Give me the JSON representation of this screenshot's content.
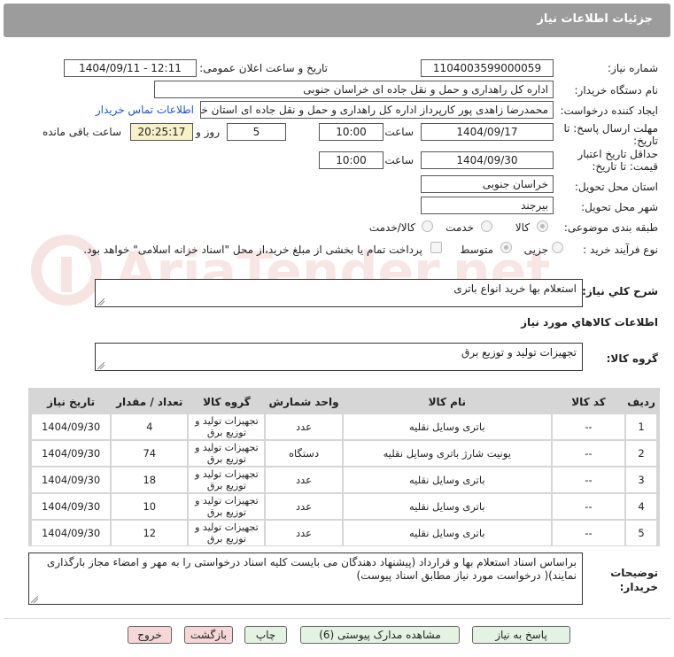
{
  "header": {
    "title": "جزئیات اطلاعات نیاز"
  },
  "fields": {
    "need_number_label": "شماره نیاز:",
    "need_number": "1104003599000059",
    "announce_label": "تاریخ و ساعت اعلان عمومی:",
    "announce_value": "1404/09/11 - 12:11",
    "buyer_org_label": "نام دستگاه خریدار:",
    "buyer_org": "اداره کل راهداری و حمل و نقل جاده ای خراسان جنوبی",
    "creator_label": "ایجاد کننده درخواست:",
    "creator": "محمدرضا زاهدی پور کارپرداز اداره کل راهداری و حمل و نقل جاده ای استان خراسا",
    "contact_link": "اطلاعات تماس خریدار",
    "deadline_label": "مهلت ارسال پاسخ: تا",
    "deadline_label2": "تاریخ:",
    "deadline_date": "1404/09/17",
    "time_label": "ساعت",
    "deadline_time": "10:00",
    "days": "5",
    "days_label": "روز و",
    "remaining_time": "20:25:17",
    "remaining_label": "ساعت باقی مانده",
    "validity_label": "حداقل تاریخ اعتبار",
    "validity_label2": "قیمت: تا تاریخ:",
    "validity_date": "1404/09/30",
    "validity_time_label": "ساعت",
    "validity_time": "10:00",
    "province_label": "استان محل تحویل:",
    "province": "خراسان جنوبی",
    "city_label": "شهر محل تحویل:",
    "city": "بیرجند",
    "category_label": "طبقه بندی موضوعی:",
    "category_options": [
      "کالا",
      "خدمت",
      "کالا/خدمت"
    ],
    "process_label": "نوع فرآیند خرید :",
    "process_options": [
      "جزیی",
      "متوسط"
    ],
    "payment_note": "پرداخت تمام یا بخشی از مبلغ خرید،از محل \"اسناد خزانه اسلامی\" خواهد بود."
  },
  "watermark": {
    "text": "AriaTender.net"
  },
  "summary": {
    "label": "شرح کلي نياز:",
    "value": "استعلام بها خرید انواع باتری"
  },
  "goods_section": {
    "title": "اطلاعات کالاهاي مورد نياز"
  },
  "goods_group": {
    "label": "گروه کالا:",
    "value": "تجهیزات تولید و توزیع برق"
  },
  "table": {
    "headers": [
      "ردیف",
      "کد کالا",
      "نام کالا",
      "واحد شمارش",
      "گروه کالا",
      "تعداد / مقدار",
      "تاریخ نیاز"
    ],
    "rows": [
      {
        "row": "1",
        "code": "--",
        "name": "باتری وسایل نقلیه",
        "unit": "عدد",
        "group": "تجهیزات تولید و توزیع برق",
        "qty": "4",
        "date": "1404/09/30"
      },
      {
        "row": "2",
        "code": "--",
        "name": "یونیت شارژ باتری وسایل نقلیه",
        "unit": "دستگاه",
        "group": "تجهیزات تولید و توزیع برق",
        "qty": "74",
        "date": "1404/09/30"
      },
      {
        "row": "3",
        "code": "--",
        "name": "باتری وسایل نقلیه",
        "unit": "عدد",
        "group": "تجهیزات تولید و توزیع برق",
        "qty": "18",
        "date": "1404/09/30"
      },
      {
        "row": "4",
        "code": "--",
        "name": "باتری وسایل نقلیه",
        "unit": "عدد",
        "group": "تجهیزات تولید و توزیع برق",
        "qty": "10",
        "date": "1404/09/30"
      },
      {
        "row": "5",
        "code": "--",
        "name": "باتری وسایل نقلیه",
        "unit": "عدد",
        "group": "تجهیزات تولید و توزیع برق",
        "qty": "12",
        "date": "1404/09/30"
      }
    ]
  },
  "buyer_notes": {
    "label1": "توضیحات",
    "label2": "خریدار:",
    "value": "براساس اسناد استعلام بها و قرارداد (پیشنهاد دهندگان می بایست کلیه اسناد درخواستی را به مهر و امضاء مجاز بارگذاری نمایند)( درخواست مورد نیاز مطابق اسناد پیوست)"
  },
  "buttons": {
    "reply": "پاسخ به نیاز",
    "view_docs": "مشاهده مدارک پیوستی (6)",
    "print": "چاپ",
    "back": "بازگشت",
    "exit": "خروج"
  }
}
